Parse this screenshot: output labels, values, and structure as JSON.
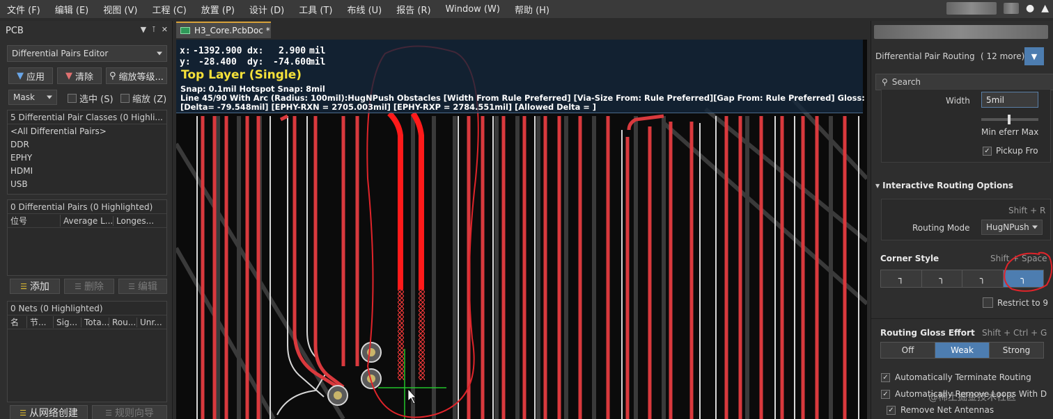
{
  "menu": [
    "文件 (F)",
    "编辑 (E)",
    "视图 (V)",
    "工程 (C)",
    "放置 (P)",
    "设计 (D)",
    "工具 (T)",
    "布线 (U)",
    "报告 (R)",
    "Window (W)",
    "帮助 (H)"
  ],
  "left_panel": {
    "title": "PCB",
    "mode_dropdown": "Differential Pairs Editor",
    "apply_button": "应用",
    "clear_button": "清除",
    "zoom_button": "缩放等级...",
    "mask_dropdown": "Mask",
    "select_label": "选中 (S)",
    "zoom_label": "缩放 (Z)",
    "classes": {
      "header": "5 Differential Pair Classes (0 Highli...",
      "items": [
        "<All Differential Pairs>",
        "DDR",
        "EPHY",
        "HDMI",
        "USB"
      ]
    },
    "pairs": {
      "header": "0 Differential Pairs (0 Highlighted)",
      "columns": [
        "位号",
        "Average L...",
        "Longes..."
      ]
    },
    "add_button": "添加",
    "delete_button": "删除",
    "edit_button": "编辑",
    "nets": {
      "header": "0 Nets (0 Highlighted)",
      "columns": [
        "名",
        "节...",
        "Sig...",
        "Tota...",
        "Rou...",
        "Unr..."
      ]
    },
    "create_from_nets_button": "从网络创建",
    "rule_wizard_button": "规则向导"
  },
  "document_tab": "H3_Core.PcbDoc *",
  "hud": {
    "x_label": "x:",
    "x_value": "-1392.900",
    "dx_label": "dx:",
    "dx_value": "2.900",
    "dx_unit": "mil",
    "y_label": "y:",
    "y_value": "-28.400",
    "dy_label": "dy:",
    "dy_value": "-74.600",
    "dy_unit": "mil",
    "layer": "Top Layer (Single)",
    "snap": "Snap: 0.1mil Hotspot Snap: 8mil",
    "line1": "Line 45/90 With Arc (Radius: 100mil):HugNPush Obstacles [Width From  Rule Preferred]  [Via-Size From: Rule Preferred][Gap From: Rule Preferred] Gloss: Weak",
    "line2": "[Delta= -79.548mil] [EPHY-RXN = 2705.003mil] [EPHY-RXP = 2784.551mil] [Allowed Delta = ]"
  },
  "right_panel": {
    "filter_title": "Differential Pair Routing",
    "filter_more": "( 12 more)",
    "search_placeholder": "Search",
    "width_label": "Width",
    "width_value": "5mil",
    "min_pref_max": "Min eferr Max",
    "pickup_label": "Pickup Fro",
    "routing_options_title": "Interactive Routing Options",
    "shift_r": "Shift + R",
    "routing_mode_label": "Routing Mode",
    "routing_mode_value": "HugNPush",
    "corner_style_label": "Corner Style",
    "corner_shortcut": "Shift + Space",
    "restrict_label": "Restrict to 9",
    "gloss_label": "Routing Gloss Effort",
    "gloss_shortcut": "Shift + Ctrl + G",
    "gloss_options": [
      "Off",
      "Weak",
      "Strong"
    ],
    "gloss_selected": "Weak",
    "auto_terminate": "Automatically Terminate Routing",
    "auto_remove": "Automatically Remove Loops With D",
    "remove_antennas": "Remove Net Antennas",
    "watermark": "@稀土掘金技术社区"
  },
  "colors": {
    "trace_red": "#d9393d",
    "trace_active": "#ff1a1a",
    "hud_layer": "#f5e13a",
    "accent_blue": "#4d7db0",
    "annotation_red": "#e0242a"
  }
}
